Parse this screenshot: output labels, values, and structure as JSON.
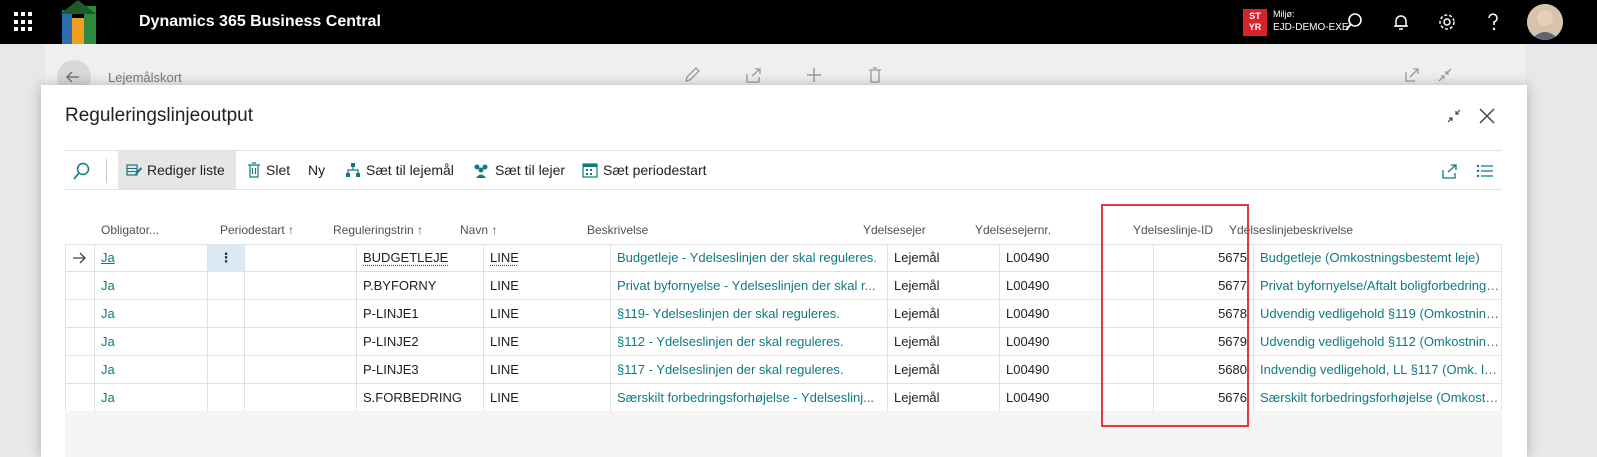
{
  "appbar": {
    "title": "Dynamics 365 Business Central",
    "env_badge_line1": "ST",
    "env_badge_line2": "YR",
    "env_label": "Miljø:",
    "env_value": "EJD-DEMO-EXE"
  },
  "background_page": {
    "title": "Lejemålskort"
  },
  "dialog": {
    "title": "Reguleringslinjeoutput",
    "actions": {
      "edit_list": "Rediger liste",
      "delete": "Slet",
      "new": "Ny",
      "set_to_lease": "Sæt til lejemål",
      "set_to_tenant": "Sæt til lejer",
      "set_period_start": "Sæt periodestart"
    }
  },
  "table": {
    "columns": {
      "obligatory": "Obligator...",
      "period_start": "Periodestart ↑",
      "regulation_step": "Reguleringstrin ↑",
      "name": "Navn ↑",
      "description": "Beskrivelse",
      "service_owner": "Ydelsesejer",
      "service_owner_no": "Ydelsesejernr.",
      "service_line_id": "Ydelseslinje-ID",
      "service_line_description": "Ydelseslinjebeskrivelse"
    },
    "rows": [
      {
        "obligatory": "Ja",
        "period_start": "",
        "regulation_step": "BUDGETLEJE",
        "name": "LINE",
        "description": "Budgetleje - Ydelseslinjen der skal reguleres.",
        "service_owner": "Lejemål",
        "service_owner_no": "L00490",
        "service_line_id": "5675",
        "service_line_description": "Budgetleje (Omkostningsbestemt leje)"
      },
      {
        "obligatory": "Ja",
        "period_start": "",
        "regulation_step": "P.BYFORNY",
        "name": "LINE",
        "description": "Privat byfornyelse - Ydelseslinjen der skal r...",
        "service_owner": "Lejemål",
        "service_owner_no": "L00490",
        "service_line_id": "5677",
        "service_line_description": "Privat byfornyelse/Aftalt boligforbedring (..."
      },
      {
        "obligatory": "Ja",
        "period_start": "",
        "regulation_step": "P-LINJE1",
        "name": "LINE",
        "description": "§119- Ydelseslinjen der skal reguleres.",
        "service_owner": "Lejemål",
        "service_owner_no": "L00490",
        "service_line_id": "5678",
        "service_line_description": "Udvendig vedligehold §119 (Omkostnings..."
      },
      {
        "obligatory": "Ja",
        "period_start": "",
        "regulation_step": "P-LINJE2",
        "name": "LINE",
        "description": "§112 - Ydelseslinjen der skal reguleres.",
        "service_owner": "Lejemål",
        "service_owner_no": "L00490",
        "service_line_id": "5679",
        "service_line_description": "Udvendig vedligehold §112 (Omkostnings..."
      },
      {
        "obligatory": "Ja",
        "period_start": "",
        "regulation_step": "P-LINJE3",
        "name": "LINE",
        "description": "§117 - Ydelseslinjen der skal reguleres.",
        "service_owner": "Lejemål",
        "service_owner_no": "L00490",
        "service_line_id": "5680",
        "service_line_description": "Indvendig vedligehold, LL §117 (Omk. leje)"
      },
      {
        "obligatory": "Ja",
        "period_start": "",
        "regulation_step": "S.FORBEDRING",
        "name": "LINE",
        "description": "Særskilt forbedringsforhøjelse - Ydelseslinj...",
        "service_owner": "Lejemål",
        "service_owner_no": "L00490",
        "service_line_id": "5676",
        "service_line_description": "Særskilt forbedringsforhøjelse (Omkostnin..."
      }
    ]
  },
  "colors": {
    "accent_link": "#0e7a83",
    "highlight_box": "#e03a3a",
    "env_badge": "#d9232a"
  }
}
